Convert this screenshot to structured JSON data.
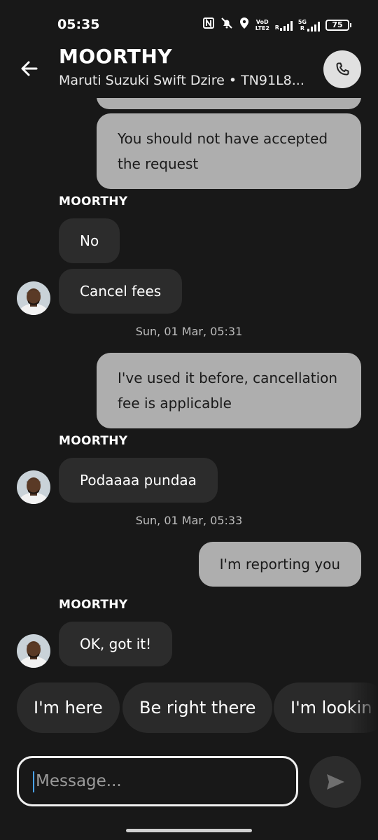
{
  "status_bar": {
    "time": "05:35",
    "icons": [
      "nfc-icon",
      "mute-icon",
      "location-icon",
      "volte-icon",
      "signal-icon",
      "5g-signal-icon"
    ],
    "volte_label": "VoD LTE2",
    "r_label": "R",
    "network_5g_label": "5G",
    "battery": "75"
  },
  "header": {
    "title": "MOORTHY",
    "subtitle": "Maruti Suzuki Swift Dzire • TN91L8..."
  },
  "messages": [
    {
      "type": "out",
      "text_lines": [
        "You should not have accepted",
        "the request"
      ]
    },
    {
      "type": "sender",
      "text": "MOORTHY"
    },
    {
      "type": "in",
      "text": "No"
    },
    {
      "type": "in",
      "text": "Cancel fees"
    },
    {
      "type": "timestamp",
      "text": "Sun, 01 Mar, 05:31"
    },
    {
      "type": "out",
      "text_lines": [
        "I've used it before, cancellation",
        "fee is applicable"
      ]
    },
    {
      "type": "sender",
      "text": "MOORTHY"
    },
    {
      "type": "in",
      "text": "Podaaaa pundaa"
    },
    {
      "type": "timestamp",
      "text": "Sun, 01 Mar, 05:33"
    },
    {
      "type": "out",
      "text": "I'm reporting you"
    },
    {
      "type": "sender",
      "text": "MOORTHY"
    },
    {
      "type": "in",
      "text": "OK, got it!"
    }
  ],
  "quick_replies": [
    "I'm here",
    "Be right there",
    "I'm lookin"
  ],
  "composer": {
    "placeholder": "Message..."
  },
  "colors": {
    "background": "#181818",
    "outgoing_bubble": "#aeaeae",
    "incoming_bubble": "#2c2c2c",
    "call_button": "#e0e0e0",
    "caret": "#4aa3ff"
  }
}
